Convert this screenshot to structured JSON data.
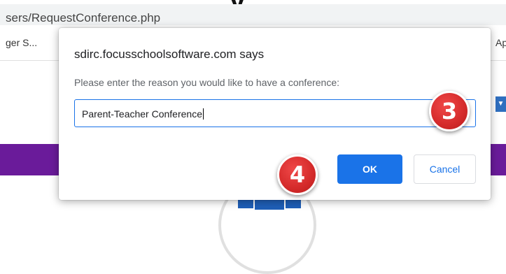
{
  "browser": {
    "url_text": "sers/RequestConference.php",
    "bookmark_left": "ger S...",
    "bookmark_right": "Ap",
    "heading_fragment": "y"
  },
  "dialog": {
    "title": "sdirc.focusschoolsoftware.com says",
    "message": "Please enter the reason you would like to have a conference:",
    "input_value": "Parent-Teacher Conference",
    "ok_label": "OK",
    "cancel_label": "Cancel"
  },
  "markers": {
    "step3": "3",
    "step4": "4"
  },
  "colors": {
    "accent": "#1a73e8",
    "purple_band": "#6a1b9a",
    "marker_red": "#d42a2a"
  }
}
